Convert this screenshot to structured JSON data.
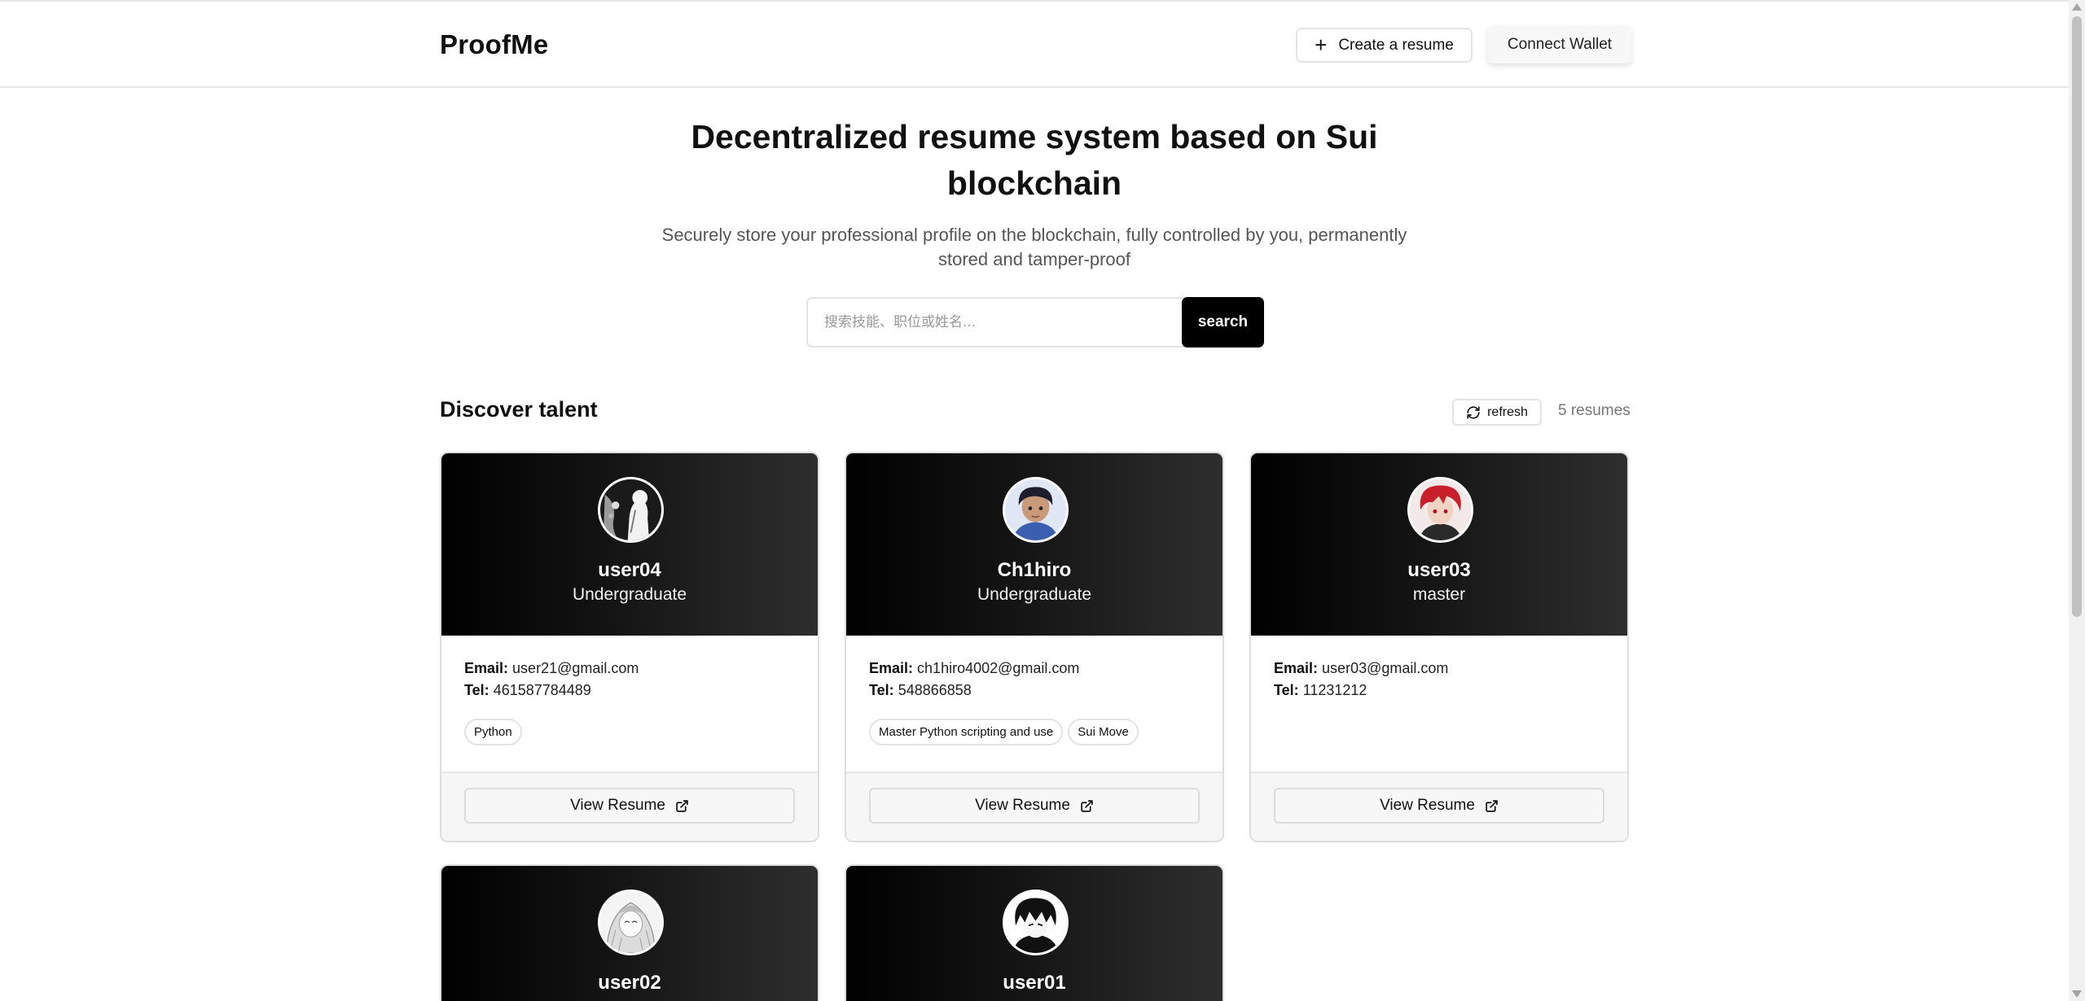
{
  "header": {
    "logo": "ProofMe",
    "create_label": "Create a resume",
    "wallet_label": "Connect Wallet"
  },
  "hero": {
    "title": "Decentralized resume system based on Sui blockchain",
    "subtitle": "Securely store your professional profile on the blockchain, fully controlled by you, permanently stored and tamper-proof"
  },
  "search": {
    "placeholder": "搜索技能、职位或姓名...",
    "button_label": "search"
  },
  "discover": {
    "title": "Discover talent",
    "refresh_label": "refresh",
    "count_text": "5 resumes"
  },
  "labels": {
    "email": "Email:",
    "tel": "Tel:",
    "view_resume": "View Resume"
  },
  "cards": [
    {
      "name": "user04",
      "level": "Undergraduate",
      "email": "user21@gmail.com",
      "tel": "461587784489",
      "tags": [
        "Python"
      ],
      "avatar_icon": "avatar-user04"
    },
    {
      "name": "Ch1hiro",
      "level": "Undergraduate",
      "email": "ch1hiro4002@gmail.com",
      "tel": "548866858",
      "tags": [
        "Master Python scripting and use",
        "Sui Move"
      ],
      "avatar_icon": "avatar-ch1hiro"
    },
    {
      "name": "user03",
      "level": "master",
      "email": "user03@gmail.com",
      "tel": "11231212",
      "tags": [],
      "avatar_icon": "avatar-user03"
    },
    {
      "name": "user02",
      "avatar_icon": "avatar-user02"
    },
    {
      "name": "user01",
      "avatar_icon": "avatar-user01"
    }
  ],
  "colors": {
    "accent": "#000000",
    "card_header_start": "#000000",
    "card_header_end": "#2e2e2e"
  }
}
